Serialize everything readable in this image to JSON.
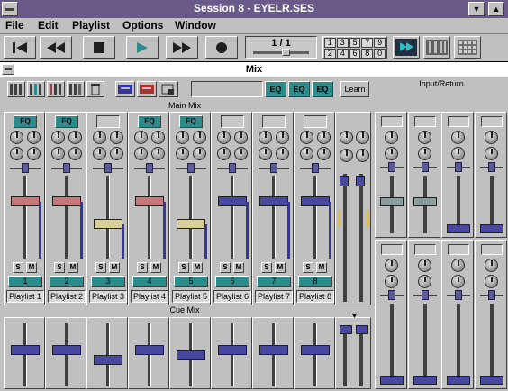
{
  "window": {
    "title": "Session 8 - EYELR.SES"
  },
  "menu": {
    "items": [
      "File",
      "Edit",
      "Playlist",
      "Options",
      "Window"
    ]
  },
  "transport": {
    "buttons": [
      "rewind-to-start",
      "rewind",
      "stop",
      "play",
      "fast-forward",
      "record"
    ],
    "counter": "1 / 1",
    "locators_top": [
      "1",
      "3",
      "5",
      "7",
      "9"
    ],
    "locators_bottom": [
      "2",
      "4",
      "6",
      "8",
      "0"
    ]
  },
  "mix": {
    "title": "Mix",
    "toolbar": {
      "eq_labels": [
        "EQ",
        "EQ",
        "EQ"
      ],
      "learn_label": "Learn"
    },
    "main_mix_label": "Main Mix",
    "cue_mix_label": "Cue Mix",
    "input_return_label": "Input/Return",
    "channels": [
      {
        "num": "1",
        "name": "Playlist 1",
        "eq": "EQ",
        "fader": 0.72,
        "fader_color": "#c87878"
      },
      {
        "num": "2",
        "name": "Playlist 2",
        "eq": "EQ",
        "fader": 0.72,
        "fader_color": "#c87878"
      },
      {
        "num": "3",
        "name": "Playlist 3",
        "eq": "",
        "fader": 0.45,
        "fader_color": "#d8d098"
      },
      {
        "num": "4",
        "name": "Playlist 4",
        "eq": "EQ",
        "fader": 0.72,
        "fader_color": "#c87878"
      },
      {
        "num": "5",
        "name": "Playlist 5",
        "eq": "EQ",
        "fader": 0.45,
        "fader_color": "#d8d098"
      },
      {
        "num": "6",
        "name": "Playlist 6",
        "eq": "",
        "fader": 0.72,
        "fader_color": "#4848a0"
      },
      {
        "num": "7",
        "name": "Playlist 7",
        "eq": "",
        "fader": 0.72,
        "fader_color": "#4848a0"
      },
      {
        "num": "8",
        "name": "Playlist 8",
        "eq": "",
        "fader": 0.72,
        "fader_color": "#4848a0"
      }
    ],
    "solo_label": "S",
    "mute_label": "M"
  },
  "colors": {
    "titlebar": "#6a5a8a",
    "teal": "#2c8c8c",
    "face": "#c0c0c0",
    "meter": "#3434a4"
  }
}
